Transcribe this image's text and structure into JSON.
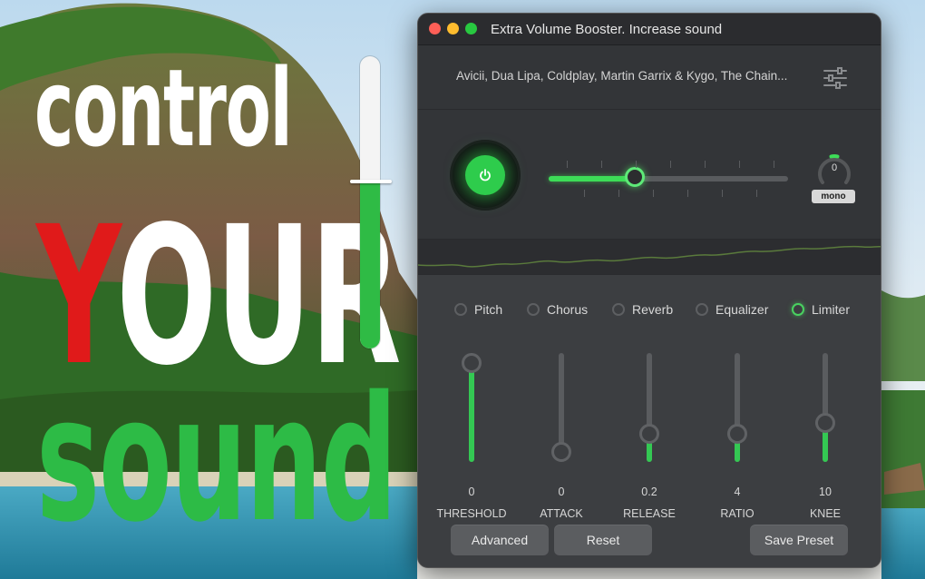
{
  "promo": {
    "line1": "control",
    "line2_first": "Y",
    "line2_rest": "OUR",
    "line3": "sound",
    "volume_level": 0.57
  },
  "window": {
    "title": "Extra Volume Booster. Increase sound",
    "track_title": "Avicii, Dua Lipa, Coldplay, Martin Garrix & Kygo, The Chain...",
    "power_on": true,
    "volume_level": 0.36,
    "knob_value": "0",
    "mono_label": "mono"
  },
  "effects": [
    {
      "label": "Pitch",
      "selected": false
    },
    {
      "label": "Chorus",
      "selected": false
    },
    {
      "label": "Reverb",
      "selected": false
    },
    {
      "label": "Equalizer",
      "selected": false
    },
    {
      "label": "Limiter",
      "selected": true
    }
  ],
  "limiter_sliders": [
    {
      "value": "0",
      "label": "THRESHOLD",
      "level": 1.0
    },
    {
      "value": "0",
      "label": "ATTACK",
      "level": 0.0
    },
    {
      "value": "0.2",
      "label": "RELEASE",
      "level": 0.2
    },
    {
      "value": "4",
      "label": "RATIO",
      "level": 0.2
    },
    {
      "value": "10",
      "label": "KNEE",
      "level": 0.33
    }
  ],
  "buttons": {
    "advanced": "Advanced",
    "reset": "Reset",
    "save_preset": "Save Preset"
  },
  "colors": {
    "accent_green": "#3ddc57",
    "promo_red": "#e01a1a",
    "promo_green": "#2dbb46"
  }
}
